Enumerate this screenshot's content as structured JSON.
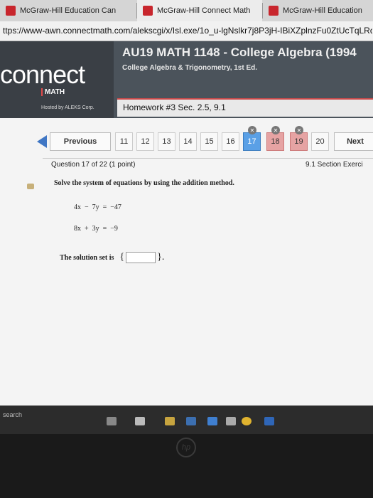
{
  "browser": {
    "tabs": [
      {
        "label": "McGraw-Hill Education Can"
      },
      {
        "label": "McGraw-Hill Connect Math"
      },
      {
        "label": "McGraw-Hill Education"
      }
    ],
    "url": "ttps://www-awn.connectmath.com/alekscgi/x/Isl.exe/1o_u-lgNslkr7j8P3jH-IBiXZplnzFu0ZtUcTqLRdUy5u9"
  },
  "header": {
    "logo": "connect",
    "product": "MATH",
    "hosted_by": "Hosted by ALEKS Corp.",
    "course_title": "AU19 MATH 1148 - College Algebra (1994",
    "course_subtitle": "College Algebra & Trigonometry, 1st Ed.",
    "homework_title": "Homework #3 Sec. 2.5, 9.1"
  },
  "nav": {
    "previous_label": "Previous",
    "next_label": "Next",
    "questions": [
      "11",
      "12",
      "13",
      "14",
      "15",
      "16",
      "17",
      "18",
      "19",
      "20"
    ]
  },
  "question": {
    "info": "Question 17 of 22 (1 point)",
    "section": "9.1 Section Exerci",
    "instruction": "Solve the system of equations by using the addition method.",
    "eq1": "4x  −  7y  =  −47",
    "eq2": "8x  +  3y  =  −9",
    "solution_label": "The solution set is",
    "brace_open": "{",
    "brace_close": "}."
  },
  "taskbar": {
    "search_text": "search"
  },
  "colors": {
    "current_question": "#5aa0e6",
    "wrong_question": "#e6a3a3",
    "header_bg": "#4b535b"
  }
}
